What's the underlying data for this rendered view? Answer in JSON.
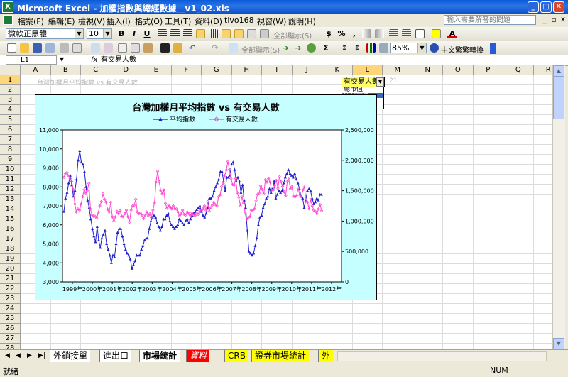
{
  "window": {
    "title": "Microsoft Excel - 加權指數與總經數據__v1_02.xls",
    "app_icon": "excel-icon"
  },
  "menu": {
    "items": [
      "檔案(F)",
      "編輯(E)",
      "檢視(V)",
      "插入(I)",
      "格式(O)",
      "工具(T)",
      "資料(D)",
      "tivo168",
      "視窗(W)",
      "說明(H)"
    ],
    "help_placeholder": "輸入需要解答的問題"
  },
  "toolbar1": {
    "font": "微軟正黑體",
    "size": "10",
    "bold": "B",
    "italic": "I",
    "underline": "U",
    "show_all": "全部顯示(S)",
    "currency": "$",
    "percent": "%",
    "comma": ","
  },
  "toolbar2": {
    "show_all": "全部顯示(S)",
    "zoom": "85%",
    "convert": "中文繁繁轉換"
  },
  "formula_bar": {
    "cell_ref": "L1",
    "fx": "fx",
    "content": "有交易人數"
  },
  "columns": [
    "A",
    "B",
    "C",
    "D",
    "E",
    "F",
    "G",
    "H",
    "I",
    "J",
    "K",
    "L",
    "M",
    "N",
    "O",
    "P",
    "Q",
    "R"
  ],
  "rows": [
    "1",
    "2",
    "3",
    "4",
    "5",
    "6",
    "7",
    "8",
    "9",
    "10",
    "11",
    "12",
    "13",
    "14",
    "15",
    "16",
    "17",
    "18",
    "19",
    "20",
    "21",
    "22",
    "23",
    "24",
    "25",
    "26",
    "27",
    "28"
  ],
  "cells": {
    "b1": "台灣加權月平均指數 vs 有交易人數",
    "m1": "21"
  },
  "dropdown": {
    "selected": "有交易人數",
    "options": [
      "總市值",
      "成交量比",
      "有交易戶數",
      "有交易人數"
    ]
  },
  "chart_data": {
    "type": "line",
    "title": "台灣加權月平均指數 vs 有交易人數",
    "legend": [
      "平均指數",
      "有交易人數"
    ],
    "legend_position": "top",
    "x_labels": [
      "1999年",
      "2000年",
      "2001年",
      "2002年",
      "2003年",
      "2004年",
      "2005年",
      "2006年",
      "2007年",
      "2008年",
      "2009年",
      "2010年",
      "2011年",
      "2012年"
    ],
    "y_left": {
      "min": 3000,
      "max": 11000,
      "ticks": [
        "3,000",
        "4,000",
        "5,000",
        "6,000",
        "7,000",
        "8,000",
        "9,000",
        "10,000",
        "11,000"
      ]
    },
    "y_right": {
      "min": 0,
      "max": 2500000,
      "ticks": [
        "0",
        "500,000",
        "1,000,000",
        "1,500,000",
        "2,000,000",
        "2,500,000"
      ]
    },
    "series": [
      {
        "name": "平均指數",
        "color": "#1f1fcc",
        "axis": "left",
        "values": [
          6700,
          7400,
          7700,
          8200,
          8600,
          8100,
          7500,
          7800,
          8400,
          9400,
          9900,
          9300,
          9200,
          8800,
          8000,
          7300,
          6900,
          6300,
          5800,
          5400,
          5100,
          5900,
          5200,
          4800,
          5300,
          5500,
          5700,
          5000,
          4700,
          4400,
          4000,
          4400,
          4300,
          5000,
          5600,
          5800,
          5800,
          5400,
          5000,
          4700,
          4500,
          4400,
          4200,
          3700,
          3900,
          4100,
          4400,
          4400,
          4400,
          4700,
          4900,
          5200,
          5300,
          5300,
          5800,
          6200,
          6400,
          6500,
          6400,
          6100,
          5900,
          5700,
          5900,
          6300,
          6300,
          6500,
          6600,
          6200,
          6000,
          5900,
          5800,
          5900,
          6000,
          6300,
          6200,
          6100,
          6000,
          6200,
          6300,
          6100,
          6300,
          6500,
          6600,
          6700,
          6800,
          6900,
          7000,
          6700,
          6500,
          6400,
          6600,
          6900,
          7400,
          7400,
          7500,
          7800,
          8000,
          8200,
          8400,
          8800,
          8800,
          8300,
          7800,
          8500,
          8500,
          8600,
          9200,
          9300,
          8900,
          8300,
          8500,
          8300,
          7700,
          8100,
          7300,
          6900,
          5700,
          4600,
          4500,
          4400,
          4500,
          4900,
          5300,
          6000,
          6400,
          6500,
          6900,
          7100,
          7400,
          7500,
          7900,
          7700,
          7900,
          8300,
          7400,
          7600,
          7800,
          7700,
          7800,
          8200,
          8500,
          8700,
          8900,
          8700,
          8600,
          8500,
          8700,
          8400,
          8200,
          7900,
          7500,
          7400,
          6900,
          7300,
          7800,
          7900,
          7800,
          7400,
          7100,
          7200,
          7400,
          7300,
          7600,
          7600
        ]
      },
      {
        "name": "有交易人數",
        "color": "#ff44cc",
        "axis": "right",
        "values": [
          1720000,
          1780000,
          1800000,
          1740000,
          1700000,
          1650000,
          1520000,
          1280000,
          1150000,
          1200000,
          1180000,
          1280000,
          1400000,
          1520000,
          1460000,
          1500000,
          1620000,
          1200000,
          1100000,
          1080000,
          1080000,
          1050000,
          1140000,
          1250000,
          1320000,
          1450000,
          1360000,
          1310000,
          1190000,
          1150000,
          1310000,
          1070000,
          1000000,
          1070000,
          1160000,
          1120000,
          1170000,
          1080000,
          1070000,
          1120000,
          1180000,
          1070000,
          980000,
          1180000,
          1250000,
          1260000,
          1360000,
          1150000,
          1120000,
          1130000,
          1090000,
          1040000,
          1100000,
          1150000,
          1090000,
          1120000,
          1060000,
          1180000,
          1300000,
          1640000,
          1820000,
          1650000,
          1500000,
          1450000,
          1510000,
          1290000,
          1210000,
          1260000,
          1230000,
          1200000,
          1250000,
          1200000,
          1200000,
          1150000,
          1090000,
          1120000,
          1180000,
          1110000,
          1100000,
          1150000,
          1120000,
          1090000,
          1140000,
          1100000,
          1090000,
          1130000,
          1110000,
          1170000,
          1170000,
          1200000,
          1250000,
          1180000,
          1320000,
          1160000,
          1220000,
          1260000,
          1310000,
          1270000,
          1250000,
          1400000,
          1430000,
          1570000,
          1620000,
          1750000,
          1840000,
          1980000,
          1850000,
          1700000,
          1600000,
          1590000,
          1700000,
          1470000,
          1390000,
          1250000,
          1410000,
          1300000,
          1130000,
          1030000,
          1060000,
          1070000,
          1180000,
          1180000,
          1200000,
          1340000,
          1440000,
          1460000,
          1580000,
          1520000,
          1450000,
          1680000,
          1640000,
          1700000,
          1640000,
          1510000,
          1510000,
          1590000,
          1670000,
          1540000,
          1730000,
          1650000,
          1570000,
          1480000,
          1420000,
          1650000,
          1690000,
          1530000,
          1570000,
          1410000,
          1400000,
          1420000,
          1540000,
          1430000,
          1400000,
          1510000,
          1560000,
          1340000,
          1310000,
          1200000,
          1350000,
          1250000,
          1180000,
          1160000,
          1120000,
          1200000,
          1270000,
          1170000
        ]
      }
    ]
  },
  "sheet_tabs": [
    "外銷接單",
    "進出口",
    "市場統計",
    "資料",
    "CRB",
    "證券市場統計",
    "外"
  ],
  "status": {
    "left": "就緒",
    "num": "NUM"
  }
}
